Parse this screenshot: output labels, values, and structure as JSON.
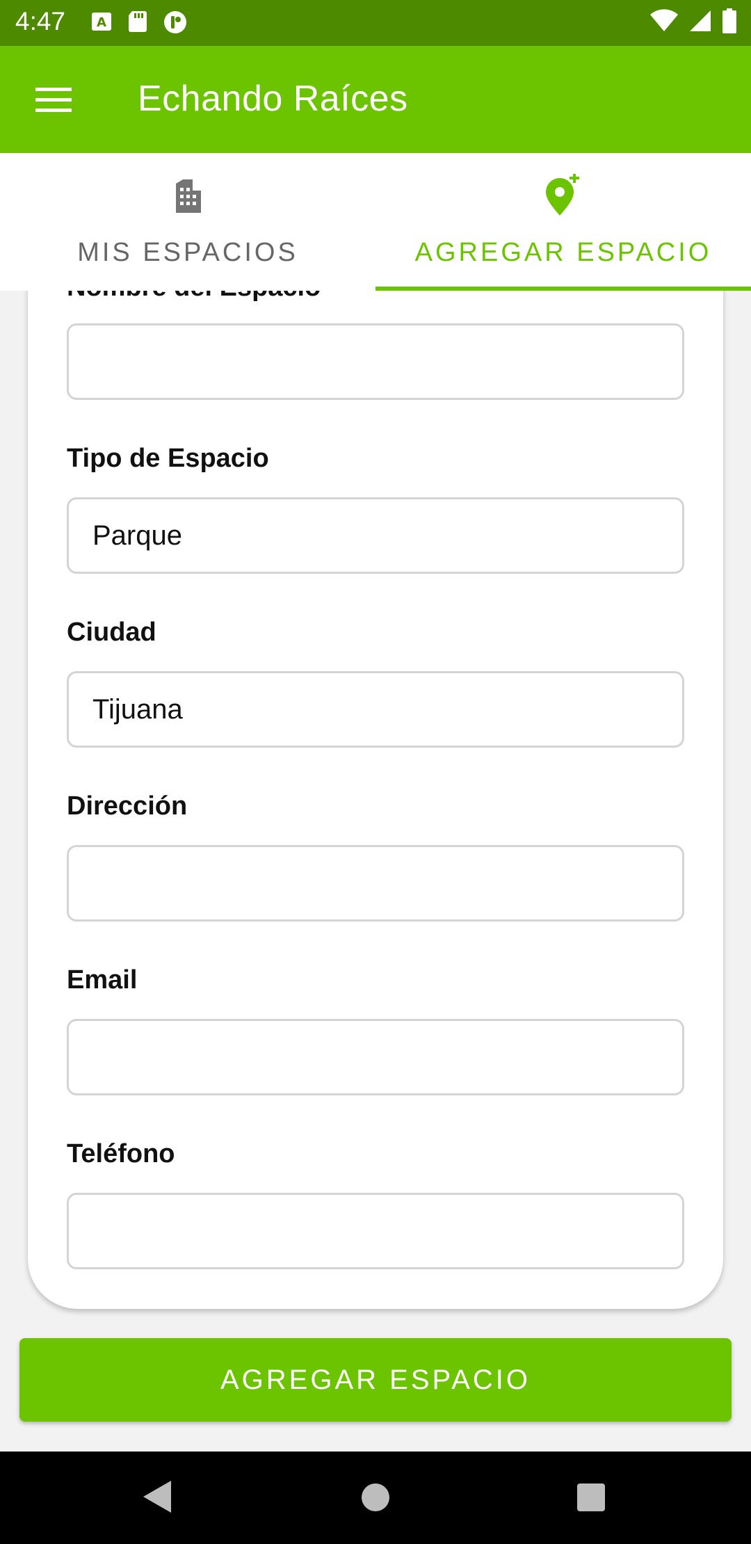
{
  "status_bar": {
    "time": "4:47",
    "left_icons": [
      "font-a-icon",
      "sd-card-icon",
      "app-notification-icon"
    ],
    "right_icons": [
      "wifi-icon",
      "signal-icon",
      "battery-icon"
    ]
  },
  "app_bar": {
    "title": "Echando Raíces",
    "menu_icon": "menu-icon"
  },
  "tabs": [
    {
      "label": "MIS ESPACIOS",
      "icon": "building-icon",
      "selected": false
    },
    {
      "label": "AGREGAR ESPACIO",
      "icon": "add-location-icon",
      "selected": true
    }
  ],
  "form": {
    "partial_label": "Nombre del Espacio",
    "fields": [
      {
        "label": "Tipo de Espacio",
        "value": "Parque"
      },
      {
        "label": "Ciudad",
        "value": "Tijuana"
      },
      {
        "label": "Dirección",
        "value": ""
      },
      {
        "label": "Email",
        "value": ""
      },
      {
        "label": "Teléfono",
        "value": ""
      }
    ],
    "submit_label": "AGREGAR ESPACIO"
  },
  "colors": {
    "accent": "#6cc400",
    "status_bar": "#4e8a00",
    "background": "#f2f2f2"
  }
}
